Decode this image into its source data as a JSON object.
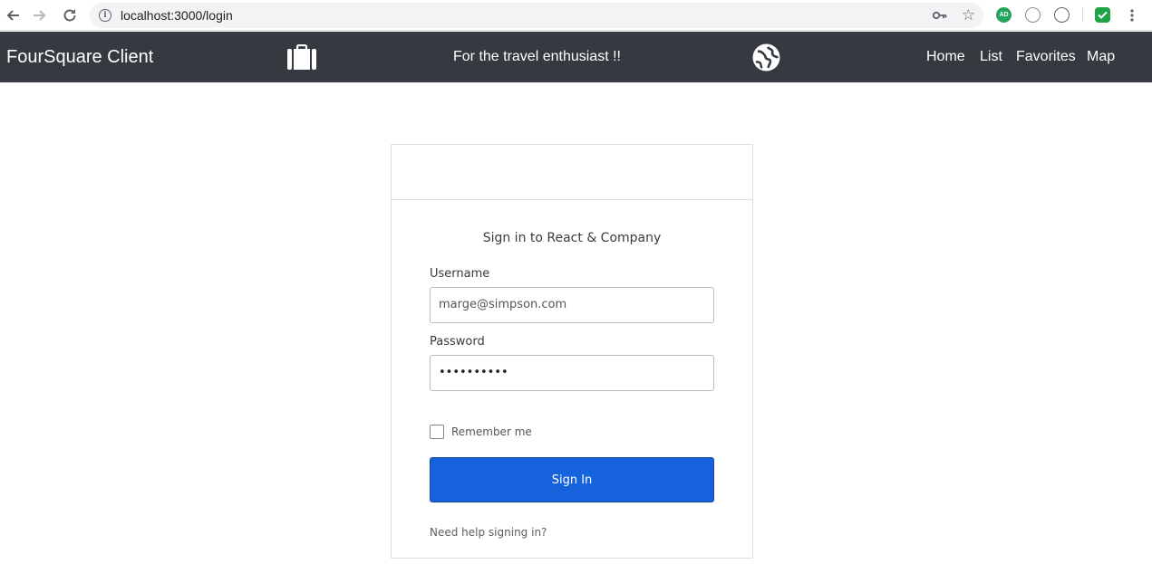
{
  "browser": {
    "url": "localhost:3000/login",
    "icons": [
      "back-icon",
      "forward-icon",
      "reload-icon",
      "info-icon",
      "key-icon",
      "star-icon",
      "adguard-icon",
      "extension-icon",
      "extension-icon",
      "shield-check-icon",
      "more-icon"
    ],
    "adguard_label": "AD"
  },
  "navbar": {
    "brand": "FourSquare Client",
    "tagline": "For the travel enthusiast !!",
    "links": [
      "Home",
      "List",
      "Favorites",
      "Map"
    ],
    "bg_color": "#343a40"
  },
  "login": {
    "title": "Sign in to React & Company",
    "username_label": "Username",
    "username_value": "marge@simpson.com",
    "password_label": "Password",
    "password_value": "••••••••••",
    "remember_label": "Remember me",
    "remember_checked": false,
    "submit_label": "Sign In",
    "help_link": "Need help signing in?",
    "button_color": "#1662dd"
  }
}
